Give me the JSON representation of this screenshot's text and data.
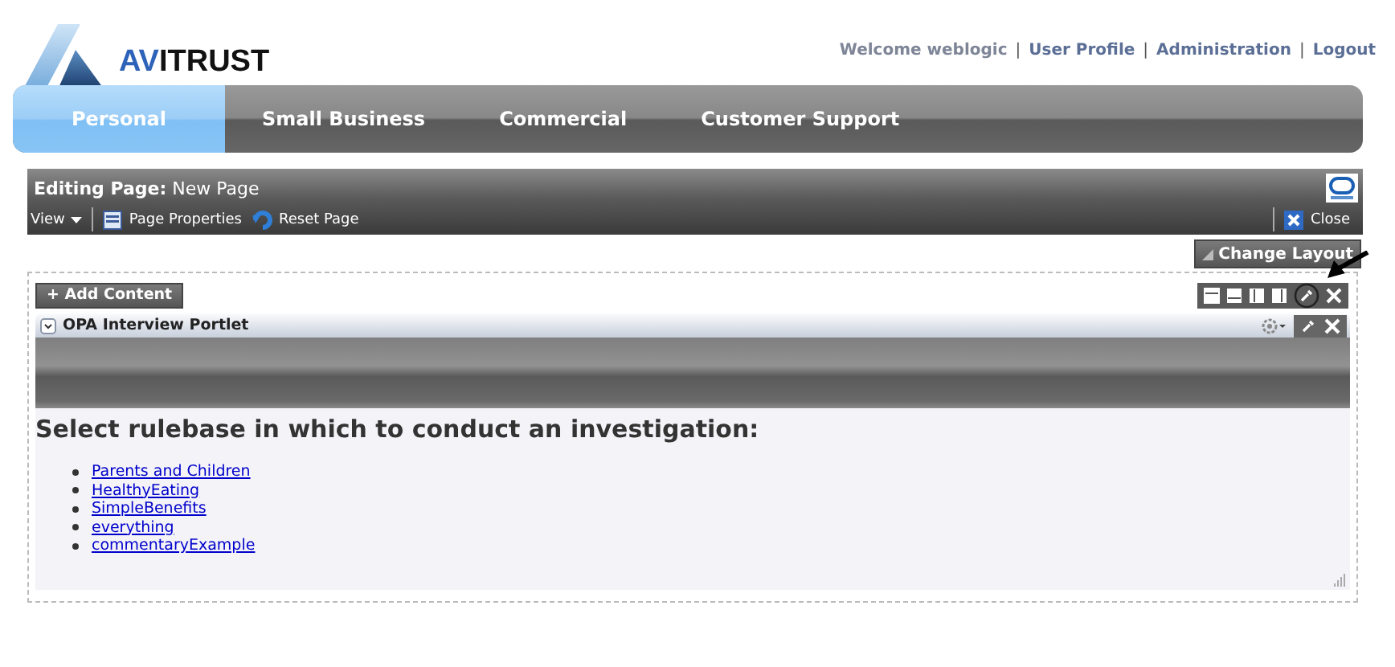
{
  "logo": {
    "text_accent": "AV",
    "text": "ITRUST"
  },
  "header_links": [
    {
      "label": "Welcome weblogic",
      "kind": "text"
    },
    {
      "label": "User Profile",
      "kind": "link",
      "separator": "|"
    },
    {
      "label": "Administration",
      "kind": "link",
      "separator": "|"
    },
    {
      "label": "Logout",
      "kind": "link",
      "separator": "|"
    }
  ],
  "tabs": [
    {
      "label": "Personal",
      "selected": true
    },
    {
      "label": "Small Business",
      "selected": false
    },
    {
      "label": "Commercial",
      "selected": false
    },
    {
      "label": "Customer Support",
      "selected": false
    }
  ],
  "editor": {
    "title_bold": "Editing Page:",
    "title": "New Page",
    "view": "View",
    "toolbar": [
      {
        "label": "Page Properties",
        "kind": "properties"
      },
      {
        "label": "Reset Page",
        "kind": "reset"
      }
    ],
    "close": "Close"
  },
  "change_layout": "Change Layout",
  "add_content": "+ Add Content",
  "portlet": {
    "title": "OPA Interview Portlet",
    "heading": "Select rulebase in which to conduct an investigation:",
    "rulebases": [
      "Parents and Children",
      "HealthyEating",
      "SimpleBenefits",
      "everything",
      "commentaryExample"
    ]
  }
}
